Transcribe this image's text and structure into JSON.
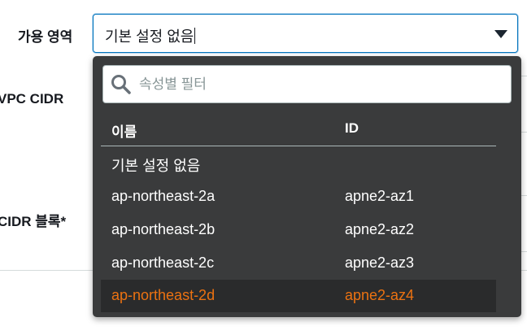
{
  "form": {
    "availability_zone_label": "가용 영역",
    "vpc_cidr_label": "VPC CIDR",
    "cidr_block_label": "CIDR 블록*"
  },
  "select": {
    "value": "기본 설정 없음"
  },
  "dropdown": {
    "filter_placeholder": "속성별 필터",
    "columns": {
      "name": "이름",
      "id": "ID"
    },
    "options": [
      {
        "name": "기본 설정 없음",
        "id": ""
      },
      {
        "name": "ap-northeast-2a",
        "id": "apne2-az1"
      },
      {
        "name": "ap-northeast-2b",
        "id": "apne2-az2"
      },
      {
        "name": "ap-northeast-2c",
        "id": "apne2-az3"
      },
      {
        "name": "ap-northeast-2d",
        "id": "apne2-az4"
      }
    ],
    "selected_index": 4
  },
  "colors": {
    "accent_focus": "#0073bb",
    "highlight_text": "#ec7211",
    "dropdown_bg": "#3a3b3c"
  }
}
